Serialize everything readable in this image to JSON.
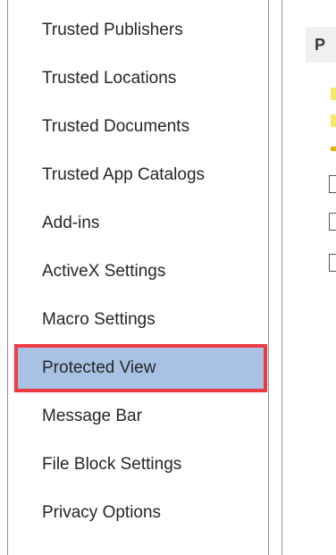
{
  "nav": {
    "items": [
      {
        "label": "Trusted Publishers",
        "selected": false
      },
      {
        "label": "Trusted Locations",
        "selected": false
      },
      {
        "label": "Trusted Documents",
        "selected": false
      },
      {
        "label": "Trusted App Catalogs",
        "selected": false
      },
      {
        "label": "Add-ins",
        "selected": false
      },
      {
        "label": "ActiveX Settings",
        "selected": false
      },
      {
        "label": "Macro Settings",
        "selected": false
      },
      {
        "label": "Protected View",
        "selected": true
      },
      {
        "label": "Message Bar",
        "selected": false
      },
      {
        "label": "File Block Settings",
        "selected": false
      },
      {
        "label": "Privacy Options",
        "selected": false
      }
    ]
  },
  "content": {
    "section_header": "P"
  },
  "colors": {
    "selection_bg": "#a8c2e3",
    "highlight_box": "#ee3a43",
    "warning_yellow": "#f5e86a"
  }
}
